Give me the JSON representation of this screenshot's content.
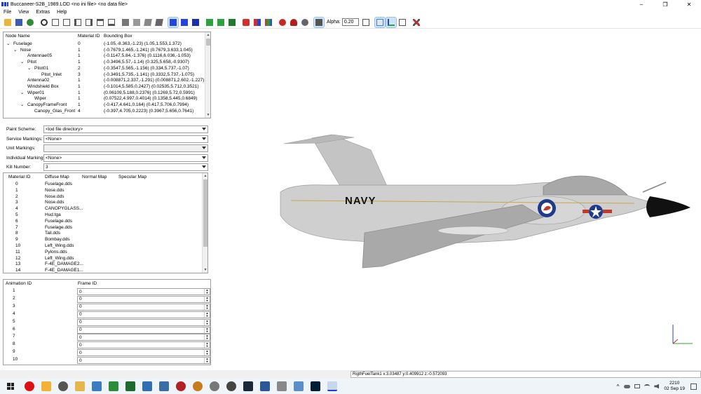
{
  "window": {
    "title": "Buccaneer-S2B_1989.LOD  <no ini file>  <no data file>",
    "controls": [
      "–",
      "❐",
      "✕"
    ]
  },
  "menu": [
    "File",
    "View",
    "Extras",
    "Help"
  ],
  "toolbar": {
    "alpha_label": "Alpha:",
    "alpha_value": "0.20"
  },
  "node_tree": {
    "columns": [
      "Node Name",
      "Material ID",
      "Bounding Box"
    ],
    "rows": [
      {
        "name": "Fuselage",
        "indent": 0,
        "toggle": "⌄",
        "mat": "0",
        "bbox": "(-1.05,-8.363,-1.23) (1.05,1.553,1.372)"
      },
      {
        "name": "Nose",
        "indent": 1,
        "toggle": "⌄",
        "mat": "1",
        "bbox": "(-0.7679,1.465,-1.241) (0.7679,3.633,1.045)"
      },
      {
        "name": "Antennae05",
        "indent": 2,
        "toggle": "",
        "mat": "1",
        "bbox": "(-0.1147,5.84,-1.376) (0.1116,6.036,-1.053)"
      },
      {
        "name": "Pitot",
        "indent": 2,
        "toggle": "⌄",
        "mat": "1",
        "bbox": "(-0.3496,5.57,-1.14) (0.325,5.658,-0.9307)"
      },
      {
        "name": "Pitot01",
        "indent": 3,
        "toggle": "⌄",
        "mat": "2",
        "bbox": "(-0.3547,5.565,-1.156) (0.334,5.737,-1.07)"
      },
      {
        "name": "Pitot_Inlet",
        "indent": 4,
        "toggle": "",
        "mat": "3",
        "bbox": "(-0.3491,5.735,-1.141) (0.3332,5.737,-1.075)"
      },
      {
        "name": "Antenna02",
        "indent": 2,
        "toggle": "",
        "mat": "1",
        "bbox": "(-0.008871,2.337,-1.291) (0.008871,2.602,-1.227)"
      },
      {
        "name": "Windshield Box",
        "indent": 2,
        "toggle": "",
        "mat": "1",
        "bbox": "(-0.1014,5.585,0.2427) (0.02535,5.712,0.3521)"
      },
      {
        "name": "Wiper01",
        "indent": 2,
        "toggle": "⌄",
        "mat": "1",
        "bbox": "(0.06109,5.188,0.2376) (0.1269,5.72,0.5991)"
      },
      {
        "name": "Wiper",
        "indent": 3,
        "toggle": "",
        "mat": "1",
        "bbox": "(0.07522,4.997,0.4014) (0.1358,5.445,0.6849)"
      },
      {
        "name": "CanopyFrameFront",
        "indent": 2,
        "toggle": "⌄",
        "mat": "1",
        "bbox": "(-0.417,4.641,0.164) (0.417,5.706,0.7994)"
      },
      {
        "name": "Canopy_Glas_Front",
        "indent": 3,
        "toggle": "",
        "mat": "4",
        "bbox": "(-0.397,4.705,0.2223) (0.3967,5.656,0.7641)"
      }
    ]
  },
  "markings": [
    {
      "label": "Paint Scheme:",
      "value": "<lod file directory>",
      "kind": "combo"
    },
    {
      "label": "Service Markings:",
      "value": "<None>",
      "kind": "combo"
    },
    {
      "label": "Unit Markings:",
      "value": "",
      "kind": "combo"
    },
    {
      "label": "Individual Markings:",
      "value": "<None>",
      "kind": "combo"
    },
    {
      "label": "Kill Number:",
      "value": "3",
      "kind": "combo"
    }
  ],
  "materials": {
    "columns": [
      "Material ID",
      "Diffuse Map",
      "Normal Map",
      "Specular Map"
    ],
    "rows": [
      {
        "id": "0",
        "diffuse": "Fuselage.dds"
      },
      {
        "id": "1",
        "diffuse": "Nose.dds"
      },
      {
        "id": "2",
        "diffuse": "Nose.dds"
      },
      {
        "id": "3",
        "diffuse": "Nose.dds"
      },
      {
        "id": "4",
        "diffuse": "CANOPYGLASS..."
      },
      {
        "id": "5",
        "diffuse": "Hud.tga"
      },
      {
        "id": "6",
        "diffuse": "Fuselage.dds"
      },
      {
        "id": "7",
        "diffuse": "Fuselage.dds"
      },
      {
        "id": "8",
        "diffuse": "Tail.dds"
      },
      {
        "id": "9",
        "diffuse": "Bombay.dds"
      },
      {
        "id": "10",
        "diffuse": "Left_Wing.dds"
      },
      {
        "id": "11",
        "diffuse": "Pylons.dds"
      },
      {
        "id": "12",
        "diffuse": "Left_Wing.dds"
      },
      {
        "id": "13",
        "diffuse": "F-4E_DAMAGE2..."
      },
      {
        "id": "14",
        "diffuse": "F-4E_DAMAGE1..."
      }
    ]
  },
  "animation": {
    "columns": [
      "Animation ID",
      "Frame ID"
    ],
    "rows": [
      {
        "id": "1",
        "frame": "0"
      },
      {
        "id": "2",
        "frame": "0"
      },
      {
        "id": "3",
        "frame": "0"
      },
      {
        "id": "4",
        "frame": "0"
      },
      {
        "id": "5",
        "frame": "0"
      },
      {
        "id": "6",
        "frame": "0"
      },
      {
        "id": "7",
        "frame": "0"
      },
      {
        "id": "8",
        "frame": "0"
      },
      {
        "id": "9",
        "frame": "0"
      },
      {
        "id": "10",
        "frame": "0"
      }
    ]
  },
  "viewport": {
    "aircraft_text": "NAVY"
  },
  "status": {
    "text": "RigthFuelTank1    x:3.03487 y:0.409912 z:-0.572093"
  },
  "taskbar": {
    "time": "2210",
    "date": "02 Sep 19",
    "tray_up": "^"
  },
  "colors": {
    "accent_blue": "#1d3dd8",
    "aircraft_body": "#c9c9c9",
    "roundel_red": "#c0392b",
    "roundel_blue": "#1f3a8a"
  }
}
